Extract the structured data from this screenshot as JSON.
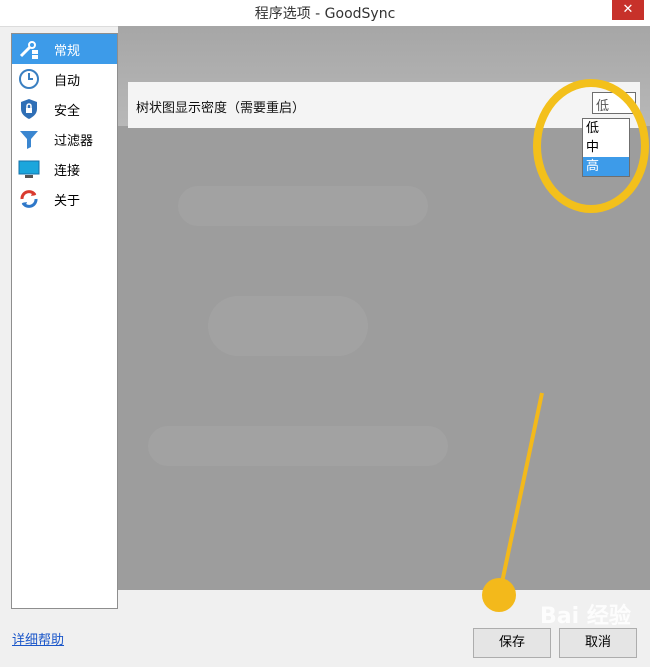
{
  "window": {
    "title": "程序选项 - GoodSync",
    "close_glyph": "✕"
  },
  "sidebar": {
    "items": [
      {
        "label": "常规",
        "icon": "wrench-check-icon",
        "active": true
      },
      {
        "label": "自动",
        "icon": "clock-icon"
      },
      {
        "label": "安全",
        "icon": "lock-icon"
      },
      {
        "label": "过滤器",
        "icon": "filter-icon"
      },
      {
        "label": "连接",
        "icon": "monitor-icon"
      },
      {
        "label": "关于",
        "icon": "refresh-icon"
      }
    ]
  },
  "settings": {
    "tree_density_label": "树状图显示密度（需要重启）",
    "tree_density_value": "低",
    "tree_density_options": [
      "低",
      "中",
      "高"
    ],
    "highlighted_option": "高"
  },
  "footer": {
    "help_link": "详细帮助",
    "save_label": "保存",
    "cancel_label": "取消"
  },
  "watermark": "Bai 经验",
  "colors": {
    "accent": "#3d9be9",
    "highlight": "#f3c01b",
    "close": "#c7312a"
  }
}
